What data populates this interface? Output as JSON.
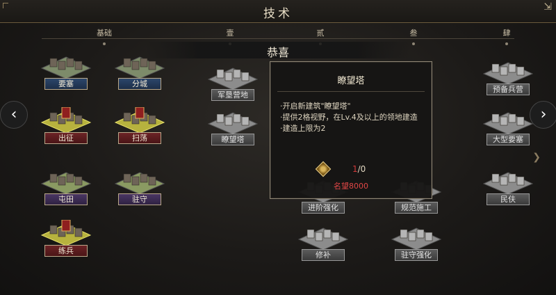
{
  "header": {
    "title": "技术"
  },
  "tiers": [
    "基础",
    "壹",
    "贰",
    "叁",
    "肆"
  ],
  "banner": {
    "text": "恭喜"
  },
  "nav": {
    "prev": "‹",
    "next": "›",
    "side_mark": "❯"
  },
  "techs": [
    {
      "id": "yaosai",
      "label": "要塞",
      "style": "blue",
      "icon": "fortress-icon"
    },
    {
      "id": "fencheng",
      "label": "分城",
      "style": "blue",
      "icon": "city-icon"
    },
    {
      "id": "junken",
      "label": "军垦营地",
      "style": "gray",
      "icon": "farm-camp-icon"
    },
    {
      "id": "yubei",
      "label": "预备兵营",
      "style": "gray",
      "icon": "barracks-icon"
    },
    {
      "id": "chuzheng",
      "label": "出征",
      "style": "red",
      "icon": "war-flag-icon"
    },
    {
      "id": "saodang",
      "label": "扫荡",
      "style": "red",
      "icon": "raid-flag-icon"
    },
    {
      "id": "liaowangta",
      "label": "瞭望塔",
      "style": "gray",
      "icon": "watchtower-icon"
    },
    {
      "id": "daxing",
      "label": "大型要塞",
      "style": "gray",
      "icon": "large-fortress-icon"
    },
    {
      "id": "tuntian",
      "label": "屯田",
      "style": "purple",
      "icon": "farmland-icon"
    },
    {
      "id": "zhushou",
      "label": "驻守",
      "style": "purple",
      "icon": "garrison-icon"
    },
    {
      "id": "jinjie",
      "label": "进阶强化",
      "style": "gray",
      "icon": "advance-icon"
    },
    {
      "id": "guifan",
      "label": "规范施工",
      "style": "gray",
      "icon": "construction-icon"
    },
    {
      "id": "minfu",
      "label": "民伕",
      "style": "gray",
      "icon": "laborer-icon"
    },
    {
      "id": "lianbing",
      "label": "练兵",
      "style": "red",
      "icon": "training-icon"
    },
    {
      "id": "xiubu",
      "label": "修补",
      "style": "gray",
      "icon": "repair-icon"
    },
    {
      "id": "zhushouqh",
      "label": "驻守强化",
      "style": "gray",
      "icon": "garrison-upgrade-icon"
    }
  ],
  "popup": {
    "title": "瞭望塔",
    "lines": [
      "·开启新建筑\"瞭望塔\"",
      "·提供2格视野，在Lv.4及以上的领地建造",
      "·建造上限为2"
    ],
    "level_current": "1",
    "level_sep": "/0",
    "fame": "名望8000"
  },
  "colors": {
    "accent": "#bba98a",
    "danger": "#e04646",
    "blue_label": "#2c466b",
    "red_label": "#6b2326"
  }
}
